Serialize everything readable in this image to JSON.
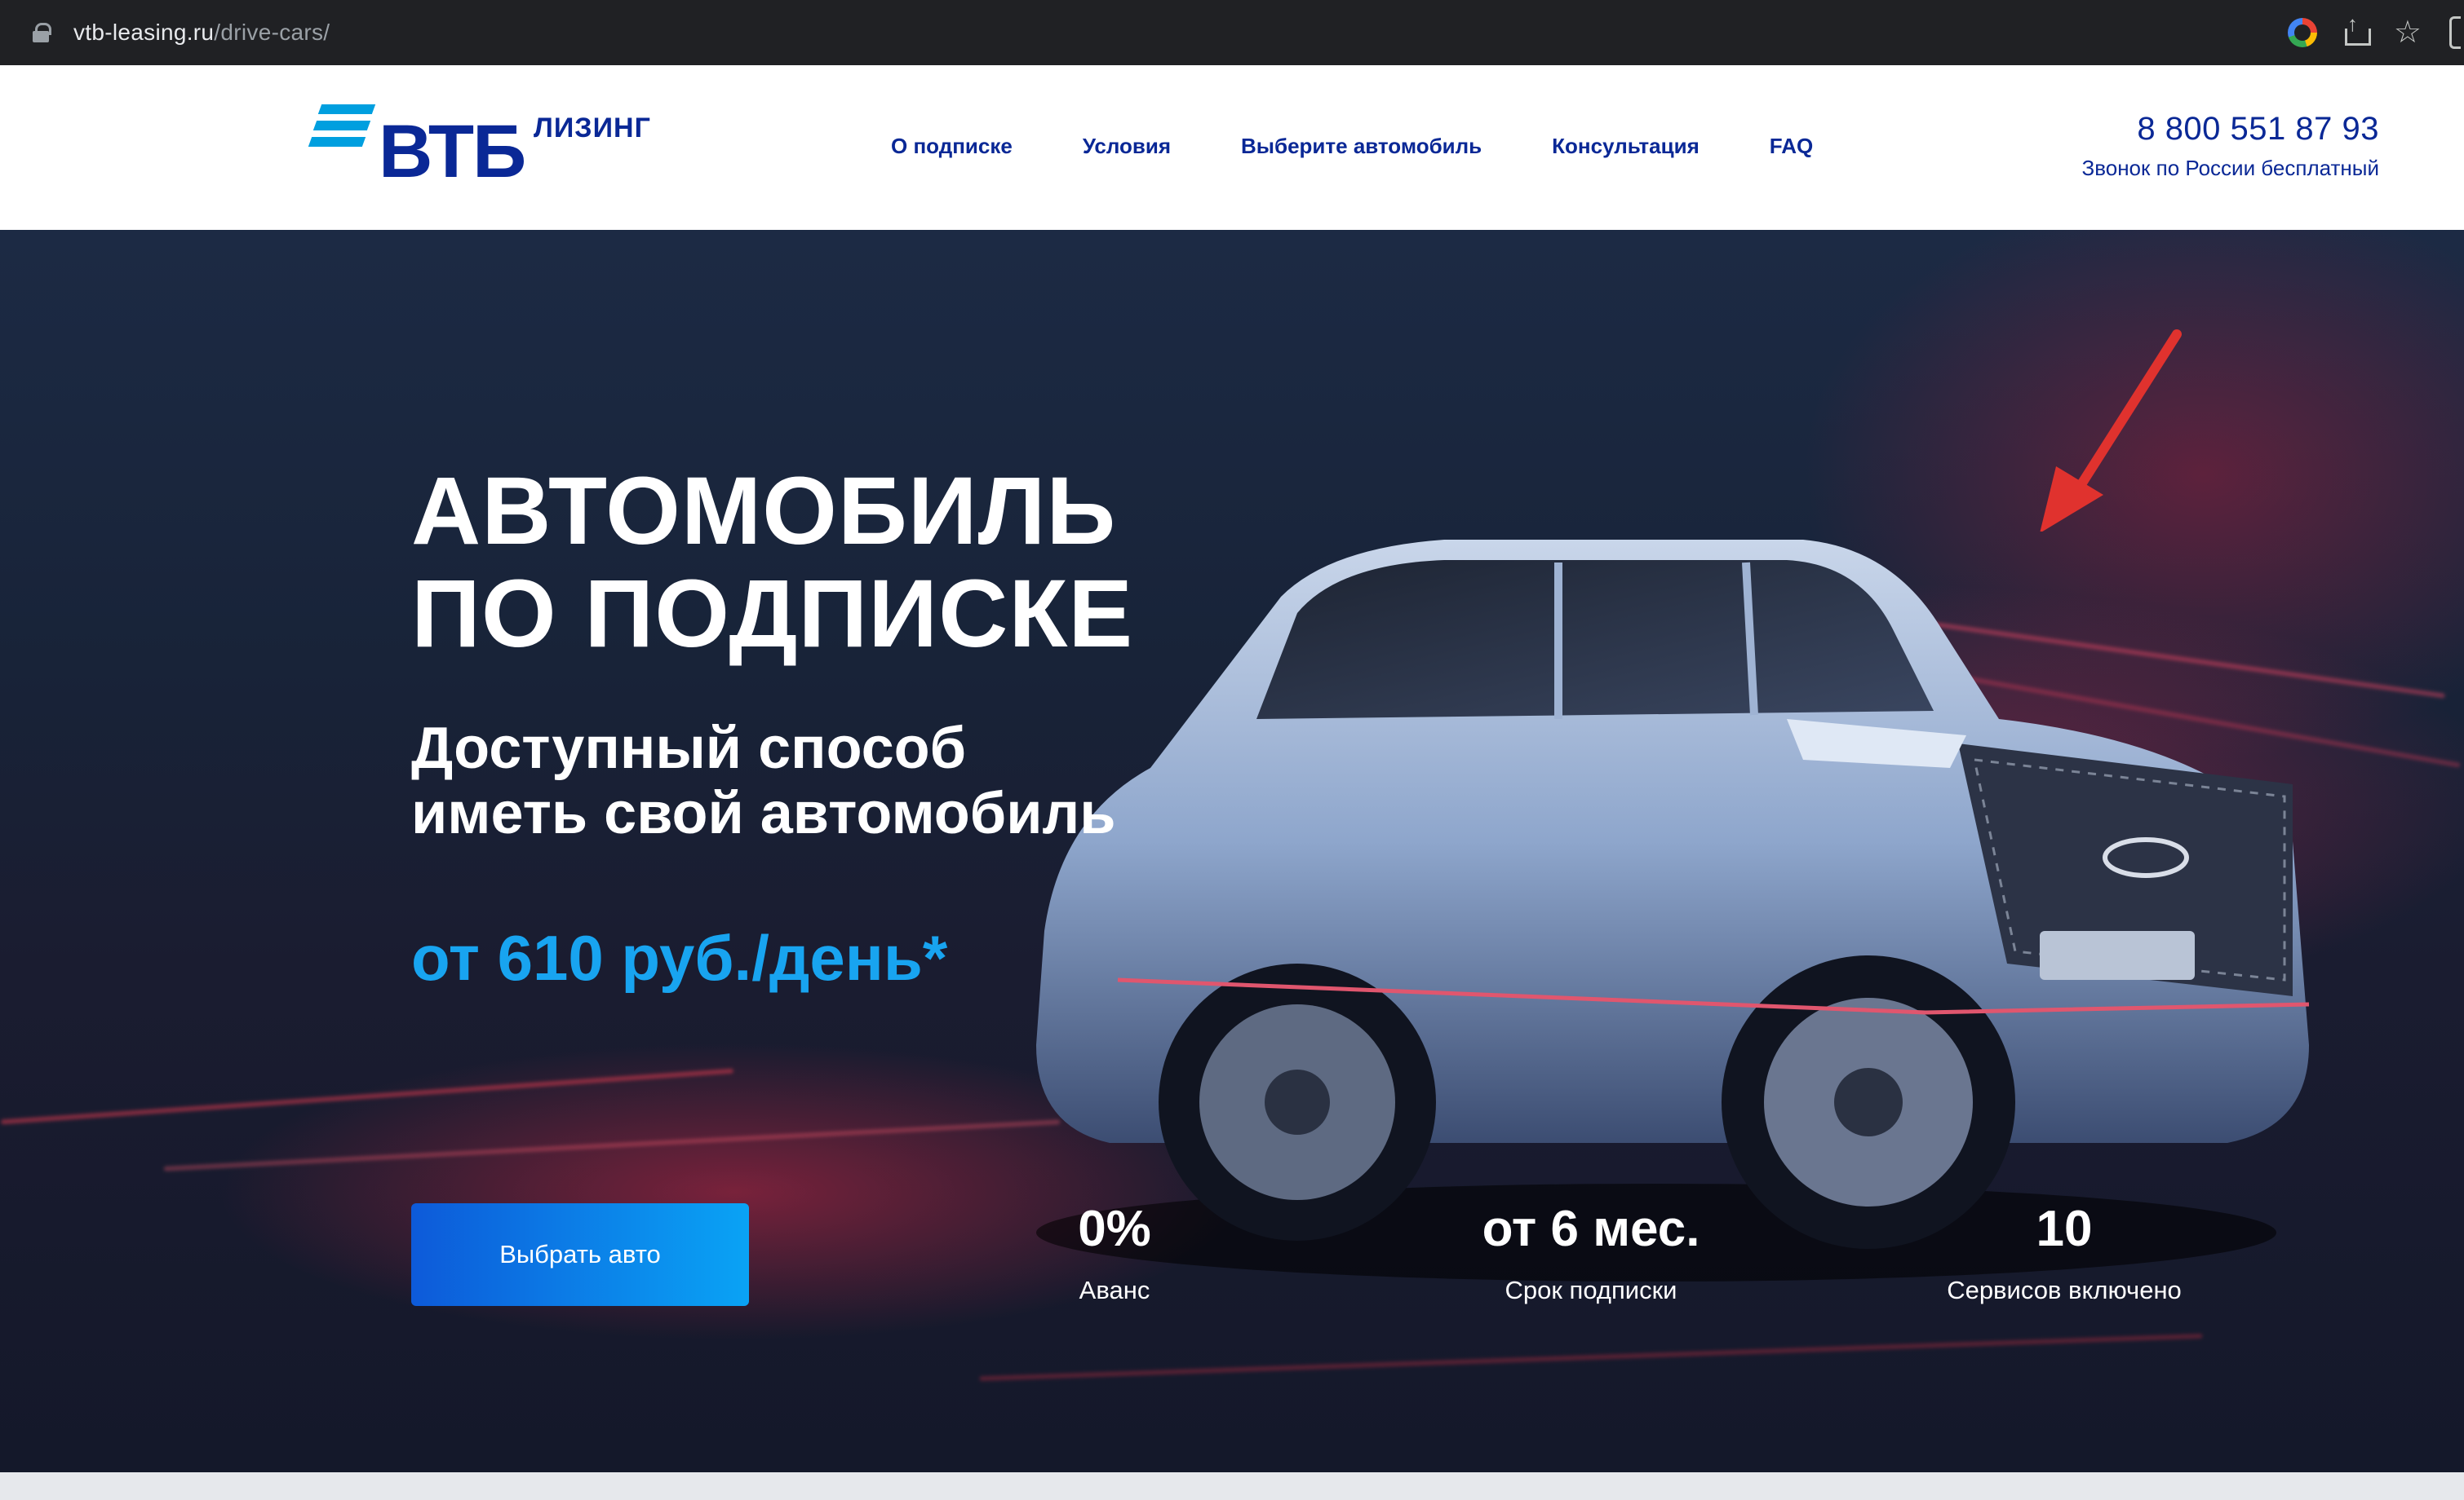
{
  "browser": {
    "url_host": "vtb-leasing.ru",
    "url_path": "/drive-cars/"
  },
  "header": {
    "logo_main": "ВТБ",
    "logo_sub": "ЛИЗИНГ",
    "nav": [
      {
        "label": "О подписке"
      },
      {
        "label": "Условия"
      },
      {
        "label": "Выберите автомобиль"
      },
      {
        "label": "Консультация"
      },
      {
        "label": "FAQ"
      }
    ],
    "phone": "8 800 551 87 93",
    "phone_note": "Звонок по России бесплатный"
  },
  "hero": {
    "title_line1": "АВТОМОБИЛЬ",
    "title_line2": "ПО ПОДПИСКЕ",
    "subtitle_line1": "Доступный способ",
    "subtitle_line2": "иметь свой автомобиль",
    "price": "от 610 руб./день*",
    "cta_label": "Выбрать авто",
    "stats": [
      {
        "value": "0%",
        "label": "Аванс"
      },
      {
        "value": "от 6 мес.",
        "label": "Срок подписки"
      },
      {
        "value": "10",
        "label": "Сервисов включено"
      }
    ]
  },
  "colors": {
    "brand_blue": "#0a2896",
    "accent_light_blue": "#18a4f0",
    "chrome_dark": "#202124",
    "annotation_red": "#e0322e"
  },
  "icons": [
    "lock-icon",
    "google-icon",
    "share-icon",
    "star-icon",
    "sidebar-icon",
    "annotation-arrow"
  ]
}
